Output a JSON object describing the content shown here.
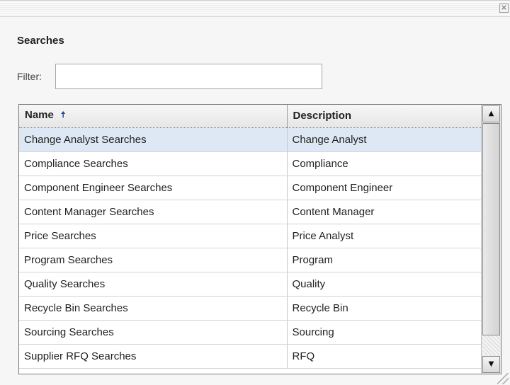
{
  "dialog": {
    "close_glyph": "×",
    "heading": "Searches"
  },
  "filter": {
    "label": "Filter:",
    "value": "",
    "placeholder": ""
  },
  "grid": {
    "columns": [
      "Name",
      "Description"
    ],
    "sorted_column": "Name",
    "sort_direction": "ascending",
    "sort_icon": "up-arrow-icon",
    "sort_glyph": "🠅",
    "selected_row_index": 0,
    "rows": [
      {
        "name": "Change Analyst Searches",
        "description": "Change Analyst"
      },
      {
        "name": "Compliance Searches",
        "description": "Compliance"
      },
      {
        "name": "Component Engineer Searches",
        "description": "Component Engineer"
      },
      {
        "name": "Content Manager Searches",
        "description": "Content Manager"
      },
      {
        "name": "Price Searches",
        "description": "Price Analyst"
      },
      {
        "name": "Program Searches",
        "description": "Program"
      },
      {
        "name": "Quality Searches",
        "description": "Quality"
      },
      {
        "name": "Recycle Bin Searches",
        "description": "Recycle Bin"
      },
      {
        "name": "Sourcing Searches",
        "description": "Sourcing"
      },
      {
        "name": "Supplier RFQ Searches",
        "description": "RFQ"
      }
    ],
    "scrollbar": {
      "up_glyph": "▲",
      "down_glyph": "▼"
    }
  },
  "colors": {
    "selected_row": "#dde8f4",
    "sort_arrow": "#1f4fa3"
  }
}
